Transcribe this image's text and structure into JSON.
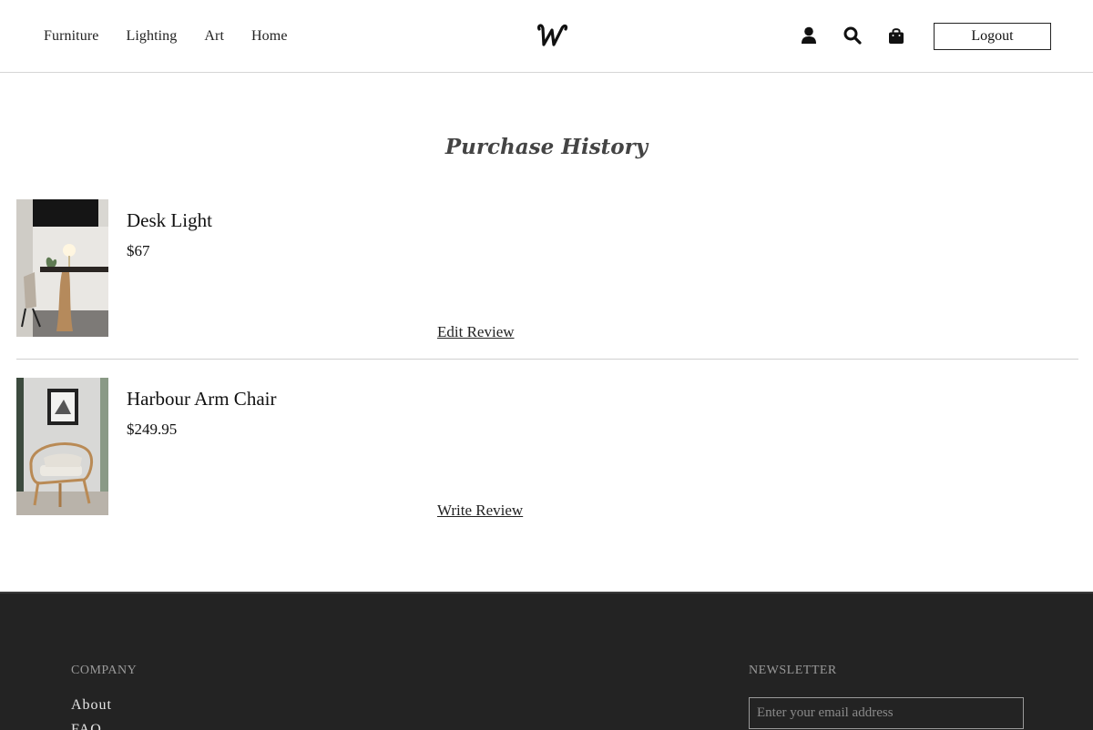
{
  "header": {
    "nav": [
      {
        "label": "Furniture"
      },
      {
        "label": "Lighting"
      },
      {
        "label": "Art"
      },
      {
        "label": "Home"
      }
    ],
    "logo_icon": "script-w-logo",
    "icons": [
      "user-icon",
      "search-icon",
      "shopping-bag-icon"
    ],
    "logout_label": "Logout"
  },
  "main": {
    "title": "Purchase History",
    "purchases": [
      {
        "name": "Desk Light",
        "price": "$67",
        "review_label": "Edit Review",
        "image": "desk-light-photo"
      },
      {
        "name": "Harbour Arm Chair",
        "price": "$249.95",
        "review_label": "Write Review",
        "image": "arm-chair-photo"
      }
    ]
  },
  "footer": {
    "company_heading": "COMPANY",
    "company_links": [
      "About",
      "FAQ"
    ],
    "newsletter_heading": "NEWSLETTER",
    "newsletter_placeholder": "Enter your email address"
  },
  "colors": {
    "footer_bg": "#232323",
    "text": "#111111",
    "divider": "#cfcfcf"
  }
}
